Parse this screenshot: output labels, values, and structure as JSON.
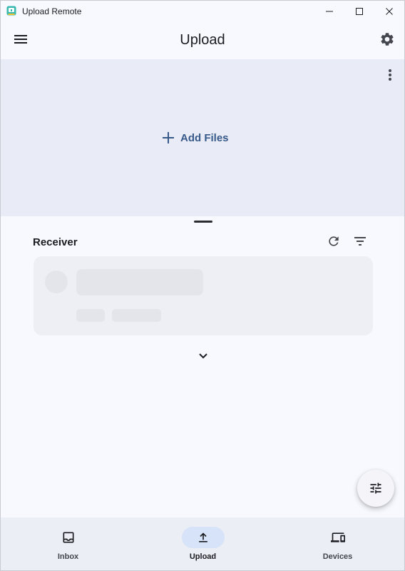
{
  "window": {
    "title": "Upload Remote",
    "app_icon": "app-logo-icon",
    "controls": [
      "minimize-icon",
      "maximize-icon",
      "close-icon"
    ]
  },
  "appbar": {
    "title": "Upload",
    "menu_icon": "hamburger-menu-icon",
    "settings_icon": "gear-icon"
  },
  "drop_area": {
    "add_files_label": "Add Files",
    "add_icon": "plus-icon",
    "more_icon": "more-vert-icon",
    "background": "#e9ebf6",
    "accent": "#385a8a"
  },
  "receiver": {
    "label": "Receiver",
    "refresh_icon": "refresh-icon",
    "filter_icon": "filter-list-icon",
    "expand_icon": "chevron-down-icon",
    "loading": true
  },
  "fab": {
    "icon": "tune-icon"
  },
  "bottom_nav": {
    "items": [
      {
        "label": "Inbox",
        "icon": "inbox-icon",
        "active": false
      },
      {
        "label": "Upload",
        "icon": "upload-icon",
        "active": true
      },
      {
        "label": "Devices",
        "icon": "devices-icon",
        "active": false
      }
    ],
    "active_color": "#d6e3f8"
  }
}
